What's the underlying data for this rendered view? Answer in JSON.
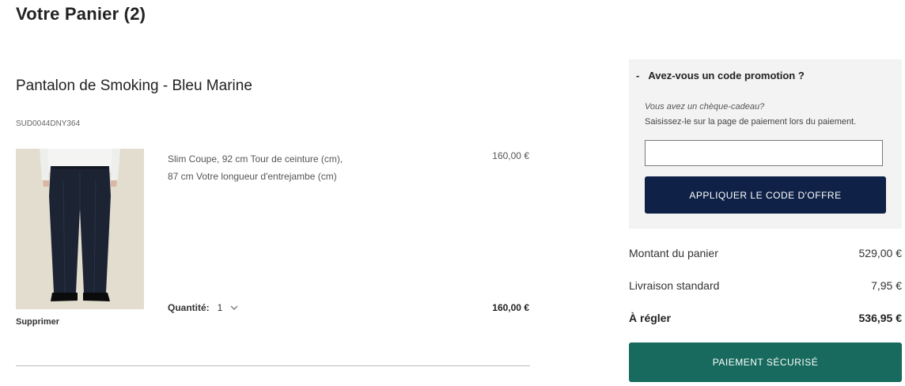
{
  "page": {
    "title": "Votre Panier (2)"
  },
  "item": {
    "name": "Pantalon de Smoking - Bleu Marine",
    "sku": "SUD0044DNY364",
    "details_line1": "Slim Coupe, 92 cm Tour de ceinture (cm),",
    "details_line2": "87 cm Votre longueur d'entrejambe (cm)",
    "unit_price": "160,00 €",
    "quantity_label": "Quantité:",
    "quantity_value": "1",
    "line_total": "160,00 €",
    "remove_label": "Supprimer",
    "image_icon": "navy-trousers-photo"
  },
  "promo": {
    "toggle_symbol": "-",
    "heading": "Avez-vous un code promotion ?",
    "gift_question": "Vous avez un chèque-cadeau?",
    "gift_note": "Saisissez-le sur la page de paiement lors du paiement.",
    "input_value": "",
    "button_label": "APPLIQUER LE CODE D'OFFRE"
  },
  "summary": {
    "subtotal_label": "Montant du panier",
    "subtotal_value": "529,00 €",
    "shipping_label": "Livraison standard",
    "shipping_value": "7,95 €",
    "total_label": "À régler",
    "total_value": "536,95 €"
  },
  "checkout": {
    "label": "PAIEMENT SÉCURISÉ"
  },
  "colors": {
    "promo_button": "#0f2146",
    "checkout_button": "#176a5d",
    "promo_panel": "#f3f3f3"
  }
}
